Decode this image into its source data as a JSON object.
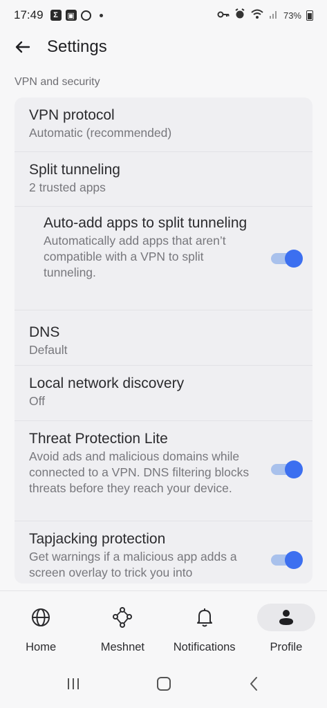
{
  "status_bar": {
    "time": "17:49",
    "battery": "73%",
    "notif_icon_1": "Σ",
    "notif_icon_2": "▣"
  },
  "header": {
    "title": "Settings"
  },
  "section": {
    "label": "VPN and security"
  },
  "settings": {
    "vpn_protocol": {
      "title": "VPN protocol",
      "sub": "Automatic (recommended)"
    },
    "split_tunneling": {
      "title": "Split tunneling",
      "sub": "2 trusted apps"
    },
    "auto_add": {
      "title": "Auto-add apps to split tunneling",
      "sub": "Automatically add apps that aren’t compatible with a VPN to split tunneling.",
      "enabled": true
    },
    "dns": {
      "title": "DNS",
      "sub": "Default"
    },
    "local_network": {
      "title": "Local network discovery",
      "sub": "Off"
    },
    "threat_protection": {
      "title": "Threat Protection Lite",
      "sub": "Avoid ads and malicious domains while connected to a VPN. DNS filtering blocks threats before they reach your device.",
      "enabled": true
    },
    "tapjacking": {
      "title": "Tapjacking protection",
      "sub": "Get warnings if a malicious app adds a screen overlay to trick you into",
      "enabled": true
    }
  },
  "nav": {
    "home": "Home",
    "meshnet": "Meshnet",
    "notifications": "Notifications",
    "profile": "Profile",
    "active": "profile"
  },
  "colors": {
    "accent": "#3c6ff0",
    "toggle_track": "#a9c1ec",
    "card_bg": "#efeff2",
    "page_bg": "#f7f7f8"
  }
}
